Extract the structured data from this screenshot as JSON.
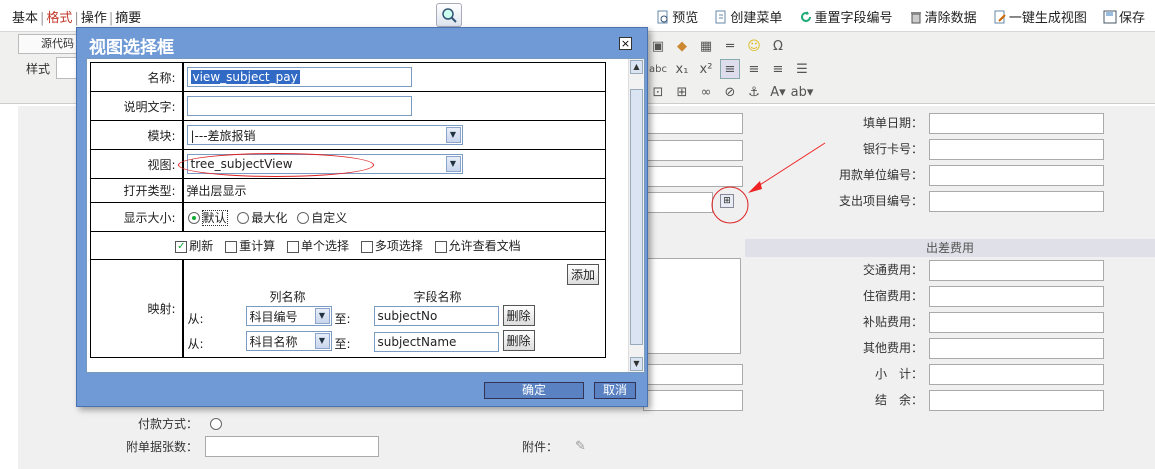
{
  "topbar": {
    "tabs": [
      "基本",
      "格式",
      "操作",
      "摘要"
    ],
    "actions": [
      {
        "label": "预览",
        "icon": "preview-icon"
      },
      {
        "label": "创建菜单",
        "icon": "new-document-icon"
      },
      {
        "label": "重置字段编号",
        "icon": "refresh-icon"
      },
      {
        "label": "清除数据",
        "icon": "trash-icon"
      },
      {
        "label": "一键生成视图",
        "icon": "edit-icon"
      },
      {
        "label": "保存",
        "icon": "save-icon"
      }
    ]
  },
  "toolbar": {
    "source_label": "源代码",
    "style_label": "样式",
    "row1": [
      "image-icon",
      "flash-icon",
      "table-icon",
      "hr-icon",
      "smiley-icon",
      "Ω"
    ],
    "row2": [
      "abc",
      "x₁",
      "x²",
      "align-left",
      "align-center",
      "align-right",
      "justify"
    ],
    "row3": [
      "⊡",
      "⊞",
      "∞",
      "⊘",
      "⚓",
      "A▾",
      "ab▾"
    ]
  },
  "form": {
    "right_labels": [
      "填单日期：",
      "银行卡号：",
      "用款单位编号：",
      "支出项目编号："
    ],
    "section_header": "出差费用",
    "expense_labels": [
      "交通费用：",
      "住宿费用：",
      "补贴费用：",
      "其他费用：",
      "小　计：",
      "结　余："
    ],
    "payment_label": "付款方式：",
    "attach_count_label": "附单据张数：",
    "attachment_label": "附件："
  },
  "dialog": {
    "title": "视图选择框",
    "close_label": "×",
    "name_label": "名称:",
    "name_value": "view_subject_pay",
    "desc_label": "说明文字:",
    "desc_value": "",
    "module_label": "模块:",
    "module_value": "|---差旅报销",
    "view_label": "视图:",
    "view_value": "tree_subjectView",
    "open_type_label": "打开类型:",
    "open_type_value": "弹出层显示",
    "size_label": "显示大小:",
    "size_options": [
      "默认",
      "最大化",
      "自定义"
    ],
    "checkboxes": [
      {
        "label": "刷新",
        "checked": true
      },
      {
        "label": "重计算",
        "checked": false
      },
      {
        "label": "单个选择",
        "checked": false
      },
      {
        "label": "多项选择",
        "checked": false
      },
      {
        "label": "允许查看文档",
        "checked": false
      }
    ],
    "mapping_label": "映射:",
    "add_label": "添加",
    "col_header": "列名称",
    "field_header": "字段名称",
    "mappings": [
      {
        "from": "从:",
        "column": "科目编号",
        "to": "至:",
        "field": "subjectNo",
        "delete": "删除"
      },
      {
        "from": "从:",
        "column": "科目名称",
        "to": "至:",
        "field": "subjectName",
        "delete": "删除"
      }
    ],
    "ok_label": "确定",
    "cancel_label": "取消"
  }
}
